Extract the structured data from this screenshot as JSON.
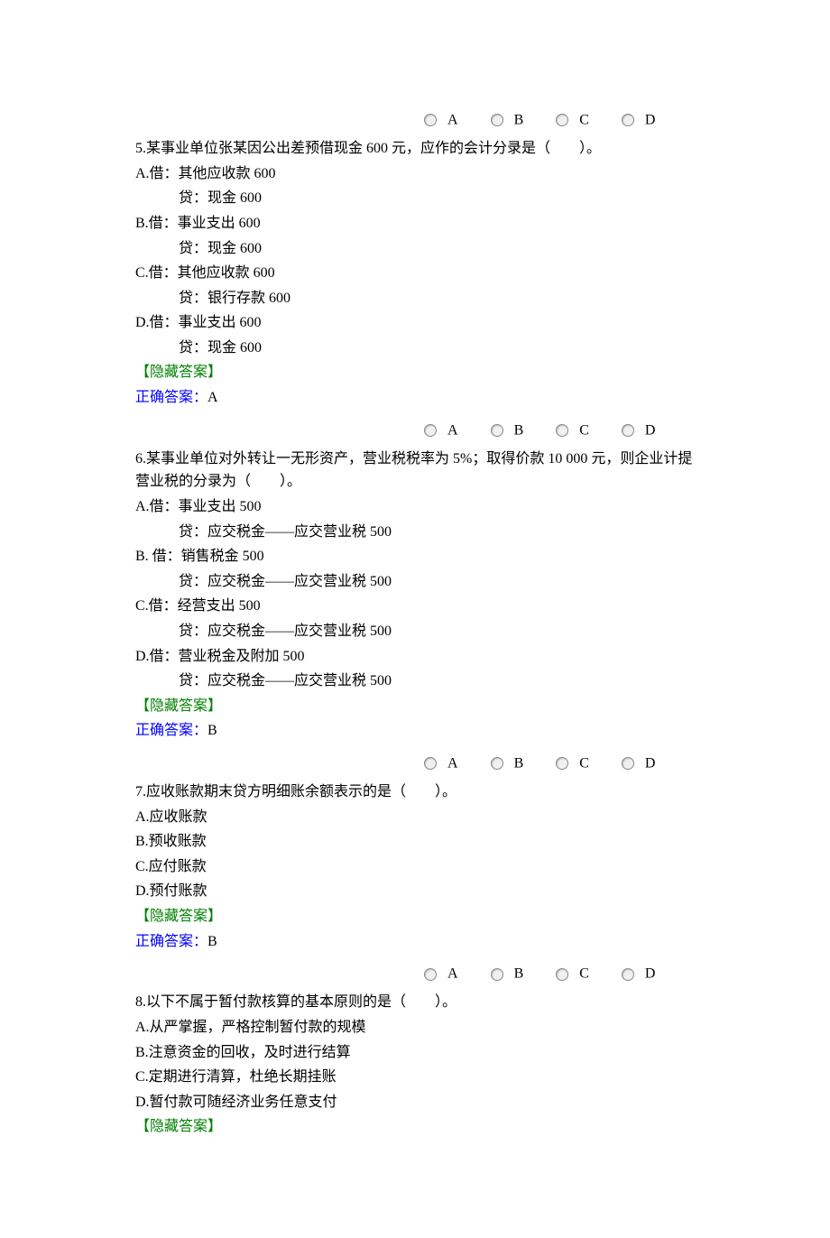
{
  "radioLabels": {
    "a": "A",
    "b": "B",
    "c": "C",
    "d": "D"
  },
  "hideAnswerLabel": "【隐藏答案】",
  "correctAnswerLabel": "正确答案：",
  "q5": {
    "stem": "5.某事业单位张某因公出差预借现金 600 元，应作的会计分录是（　　）。",
    "optA_l1": "A.借：其他应收款  600",
    "optA_l2": "贷：现金  600",
    "optB_l1": "B.借：事业支出  600",
    "optB_l2": "贷：现金  600",
    "optC_l1": "C.借：其他应收款  600",
    "optC_l2": "贷：银行存款  600",
    "optD_l1": "D.借：事业支出  600",
    "optD_l2": "贷：现金  600",
    "answer": "A"
  },
  "q6": {
    "stem": "6.某事业单位对外转让一无形资产，营业税税率为 5%；取得价款 10 000 元，则企业计提营业税的分录为（　　）。",
    "optA_l1": "A.借：事业支出  500",
    "optA_l2": "贷：应交税金——应交营业税  500",
    "optB_l1": "B. 借：销售税金  500",
    "optB_l2": "贷：应交税金——应交营业税  500",
    "optC_l1": "C.借：经营支出  500",
    "optC_l2": "贷：应交税金——应交营业税  500",
    "optD_l1": "D.借：营业税金及附加  500",
    "optD_l2": "贷：应交税金——应交营业税  500",
    "answer": "B"
  },
  "q7": {
    "stem": "7.应收账款期末贷方明细账余额表示的是（　　）。",
    "optA": "A.应收账款",
    "optB": "B.预收账款",
    "optC": "C.应付账款",
    "optD": "D.预付账款",
    "answer": "B"
  },
  "q8": {
    "stem": "8.以下不属于暂付款核算的基本原则的是（　　）。",
    "optA": "A.从严掌握，严格控制暂付款的规模",
    "optB": "B.注意资金的回收，及时进行结算",
    "optC": "C.定期进行清算，杜绝长期挂账",
    "optD": "D.暂付款可随经济业务任意支付"
  }
}
